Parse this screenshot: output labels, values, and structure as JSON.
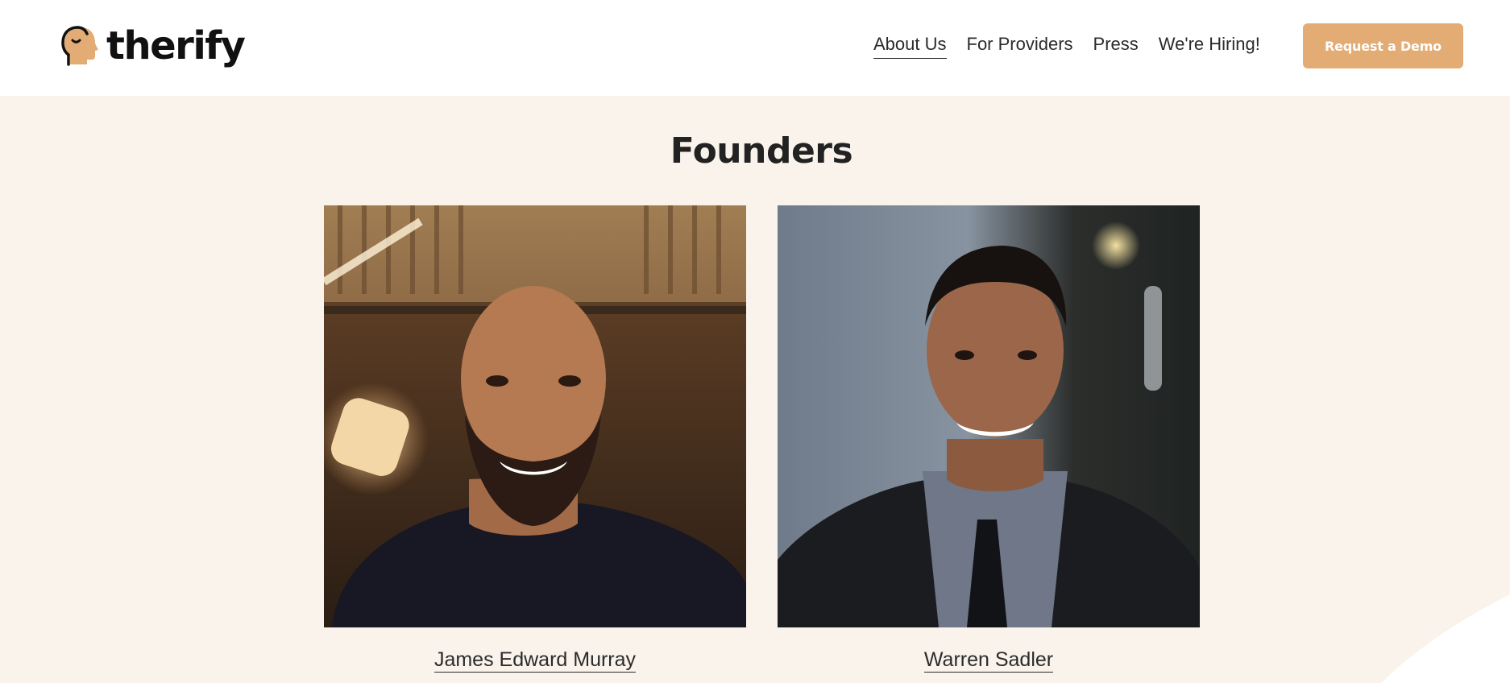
{
  "brand": {
    "name": "therify",
    "accent_color": "#e2ac74",
    "background_color": "#faf3ec"
  },
  "nav": {
    "items": [
      {
        "label": "About Us",
        "active": true
      },
      {
        "label": "For Providers",
        "active": false
      },
      {
        "label": "Press",
        "active": false
      },
      {
        "label": "We're Hiring!",
        "active": false
      }
    ],
    "cta_label": "Request a Demo"
  },
  "founders": {
    "title": "Founders",
    "people": [
      {
        "name": "James Edward Murray",
        "photo": "founder-photo"
      },
      {
        "name": "Warren Sadler",
        "photo": "founder-photo"
      }
    ]
  }
}
